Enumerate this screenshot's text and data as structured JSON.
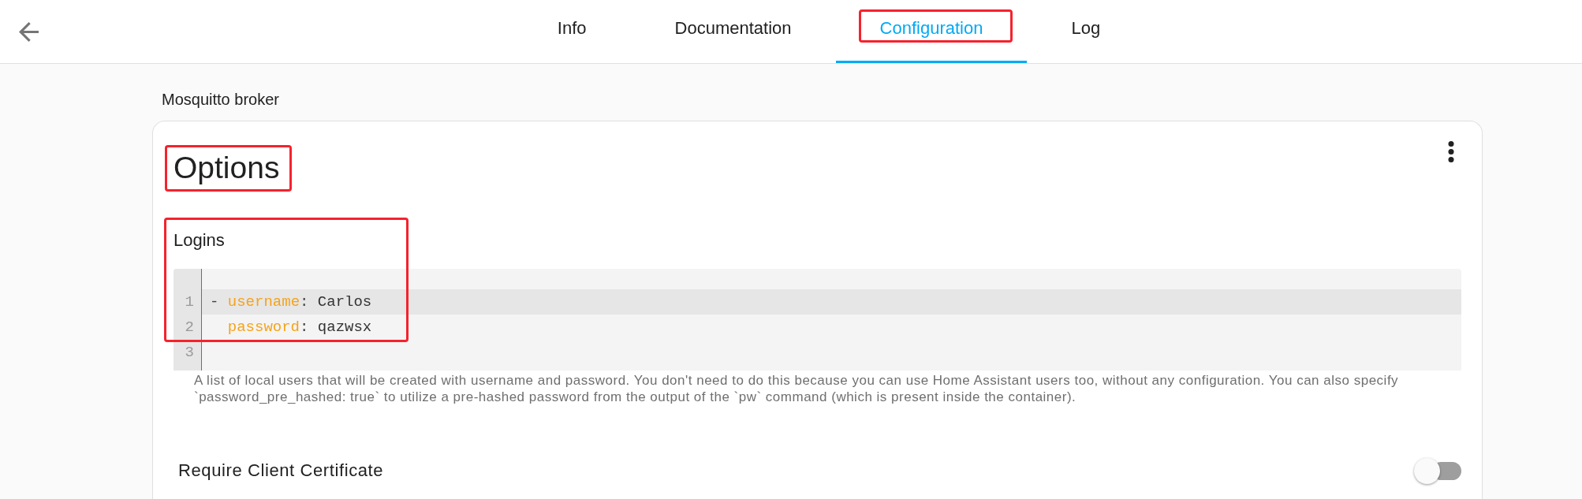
{
  "top_bar": {
    "tabs": [
      {
        "label": "Info",
        "selected": false,
        "annotated": false
      },
      {
        "label": "Documentation",
        "selected": false,
        "annotated": false
      },
      {
        "label": "Configuration",
        "selected": true,
        "annotated": true
      },
      {
        "label": "Log",
        "selected": false,
        "annotated": false
      }
    ]
  },
  "addon_name": "Mosquitto broker",
  "card": {
    "title": "Options",
    "title_annotated": true,
    "logins": {
      "label": "Logins",
      "annotated": true,
      "editor": {
        "lines": [
          {
            "number": "1",
            "active": true,
            "indented": false,
            "tokens": [
              {
                "kind": "punct",
                "text": "- "
              },
              {
                "kind": "key",
                "text": "username"
              },
              {
                "kind": "punct",
                "text": ": "
              },
              {
                "kind": "value",
                "text": "Carlos"
              }
            ]
          },
          {
            "number": "2",
            "active": false,
            "indented": true,
            "tokens": [
              {
                "kind": "key",
                "text": "password"
              },
              {
                "kind": "punct",
                "text": ": "
              },
              {
                "kind": "value",
                "text": "qazwsx"
              }
            ]
          },
          {
            "number": "3",
            "active": false
          }
        ]
      },
      "description": "A list of local users that will be created with username and password. You don't need to do this because you can use Home Assistant users too, without any configuration. You can also specify `password_pre_hashed: true` to utilize a pre-hashed password from the output of the `pw` command (which is present inside the container)."
    },
    "settings": [
      {
        "kind": "toggle",
        "label": "Require Client Certificate",
        "on": false
      }
    ]
  }
}
